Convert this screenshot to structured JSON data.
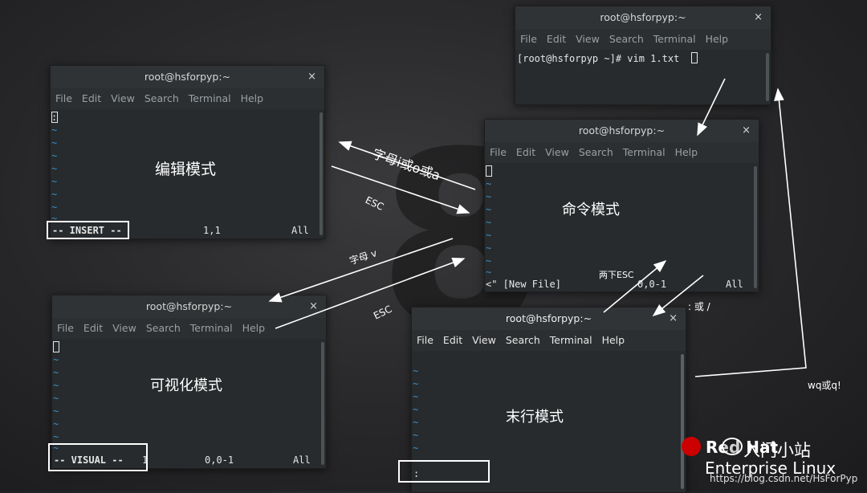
{
  "menu": [
    "File",
    "Edit",
    "View",
    "Search",
    "Terminal",
    "Help"
  ],
  "close_glyph": "×",
  "tilde": "~",
  "top_window": {
    "title": "root@hsforpyp:~",
    "prompt": "[root@hsforpyp ~]# vim 1.txt"
  },
  "insert_window": {
    "title": "root@hsforpyp:~",
    "first_line": ":",
    "mode_label": "编辑模式",
    "status_mode": "-- INSERT --",
    "status_pos": "1,1",
    "status_all": "All"
  },
  "visual_window": {
    "title": "root@hsforpyp:~",
    "mode_label": "可视化模式",
    "status_mode": "-- VISUAL --",
    "status_extra": "1",
    "status_pos": "0,0-1",
    "status_all": "All"
  },
  "command_window": {
    "title": "root@hsforpyp:~",
    "mode_label": "命令模式",
    "status_file": "<\" [New File]",
    "status_pos": "0,0-1",
    "status_all": "All"
  },
  "lastline_window": {
    "title": "root@hsforpyp:~",
    "mode_label": "末行模式",
    "prompt": ":"
  },
  "arrow_labels": {
    "to_insert": "字母i或o或a",
    "esc1": "ESC",
    "to_visual": "字母 v",
    "esc2": "ESC",
    "two_esc": "两下ESC",
    "colon_or_slash": ": 或 /",
    "wq": "wq或q!"
  },
  "branding": {
    "bg_number": "8",
    "redhat": "Red Hat",
    "enterprise": "Enterprise Linux",
    "wechat": "入门小站",
    "watermark": "https://blog.csdn.net/HsForPyp"
  },
  "colors": {
    "tilde": "#3d8ec9",
    "redhat": "#cc0000",
    "background": "#2a2a2c"
  }
}
